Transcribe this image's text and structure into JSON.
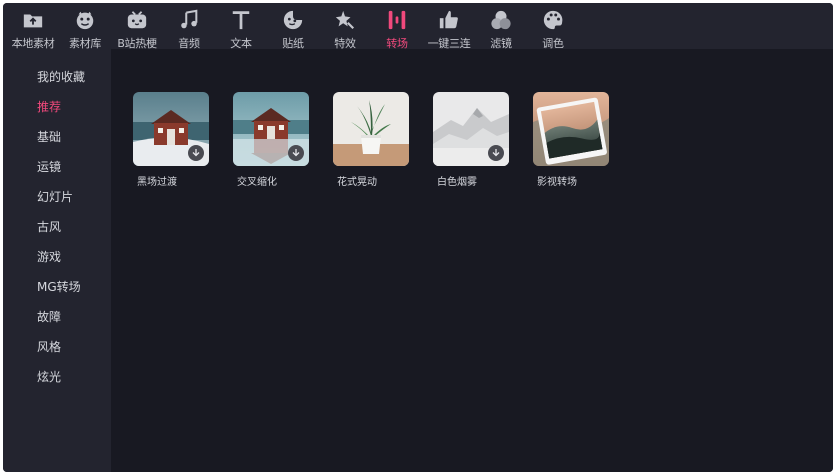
{
  "toolbar": {
    "items": [
      {
        "label": "本地素材",
        "icon": "folder-upload-icon"
      },
      {
        "label": "素材库",
        "icon": "material-library-icon"
      },
      {
        "label": "B站热梗",
        "icon": "bilibili-tv-icon"
      },
      {
        "label": "音频",
        "icon": "music-note-icon"
      },
      {
        "label": "文本",
        "icon": "text-t-icon"
      },
      {
        "label": "贴纸",
        "icon": "sticker-face-icon"
      },
      {
        "label": "特效",
        "icon": "effect-star-icon"
      },
      {
        "label": "转场",
        "icon": "transition-bars-icon"
      },
      {
        "label": "一键三连",
        "icon": "thumbs-up-icon"
      },
      {
        "label": "滤镜",
        "icon": "filter-circles-icon"
      },
      {
        "label": "调色",
        "icon": "palette-icon"
      }
    ],
    "active_index": 7,
    "active_color": "#f0497c"
  },
  "sidebar": {
    "items": [
      {
        "label": "我的收藏"
      },
      {
        "label": "推荐"
      },
      {
        "label": "基础"
      },
      {
        "label": "运镜"
      },
      {
        "label": "幻灯片"
      },
      {
        "label": "古风"
      },
      {
        "label": "游戏"
      },
      {
        "label": "MG转场"
      },
      {
        "label": "故障"
      },
      {
        "label": "风格"
      },
      {
        "label": "炫光"
      }
    ],
    "active_index": 1
  },
  "content": {
    "cards": [
      {
        "label": "黑场过渡",
        "download": true
      },
      {
        "label": "交叉缩化",
        "download": true
      },
      {
        "label": "花式晃动",
        "download": false
      },
      {
        "label": "白色烟雾",
        "download": true
      },
      {
        "label": "影视转场",
        "download": false
      }
    ]
  }
}
